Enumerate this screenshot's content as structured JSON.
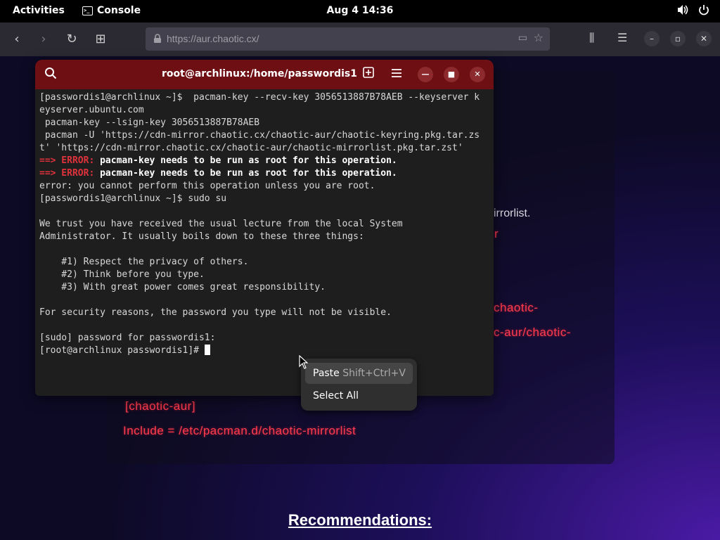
{
  "topbar": {
    "activities": "Activities",
    "app_name": "Console",
    "clock": "Aug 4  14:36"
  },
  "browser": {
    "url": "https://aur.chaotic.cx/"
  },
  "page": {
    "fragments": [
      "irrorlist.",
      "r",
      "chaotic-",
      "c-aur/chaotic-",
      "[chaotic-aur]",
      "Include = /etc/pacman.d/chaotic-mirrorlist"
    ],
    "recommendations": "Recommendations:"
  },
  "terminal": {
    "title": "root@archlinux:/home/passwordis1",
    "lines": [
      {
        "type": "plain",
        "text": "[passwordis1@archlinux ~]$  pacman-key --recv-key 3056513887B78AEB --keyserver k"
      },
      {
        "type": "plain",
        "text": "eyserver.ubuntu.com"
      },
      {
        "type": "plain",
        "text": " pacman-key --lsign-key 3056513887B78AEB"
      },
      {
        "type": "plain",
        "text": " pacman -U 'https://cdn-mirror.chaotic.cx/chaotic-aur/chaotic-keyring.pkg.tar.zs"
      },
      {
        "type": "plain",
        "text": "t' 'https://cdn-mirror.chaotic.cx/chaotic-aur/chaotic-mirrorlist.pkg.tar.zst'"
      },
      {
        "type": "error",
        "tag": "==> ERROR: ",
        "text": "pacman-key needs to be run as root for this operation."
      },
      {
        "type": "error",
        "tag": "==> ERROR: ",
        "text": "pacman-key needs to be run as root for this operation."
      },
      {
        "type": "plain",
        "text": "error: you cannot perform this operation unless you are root."
      },
      {
        "type": "plain",
        "text": "[passwordis1@archlinux ~]$ sudo su"
      },
      {
        "type": "plain",
        "text": ""
      },
      {
        "type": "plain",
        "text": "We trust you have received the usual lecture from the local System"
      },
      {
        "type": "plain",
        "text": "Administrator. It usually boils down to these three things:"
      },
      {
        "type": "plain",
        "text": ""
      },
      {
        "type": "plain",
        "text": "    #1) Respect the privacy of others."
      },
      {
        "type": "plain",
        "text": "    #2) Think before you type."
      },
      {
        "type": "plain",
        "text": "    #3) With great power comes great responsibility."
      },
      {
        "type": "plain",
        "text": ""
      },
      {
        "type": "plain",
        "text": "For security reasons, the password you type will not be visible."
      },
      {
        "type": "plain",
        "text": ""
      },
      {
        "type": "plain",
        "text": "[sudo] password for passwordis1:"
      },
      {
        "type": "prompt",
        "text": "[root@archlinux passwordis1]# "
      }
    ]
  },
  "context_menu": {
    "items": [
      {
        "label": "Paste",
        "accel": "Shift+Ctrl+V"
      },
      {
        "label": "Select All",
        "accel": ""
      }
    ]
  },
  "colors": {
    "terminal_header": "#6e0f14",
    "error_red": "#e0323c",
    "page_red": "#ff3b4e"
  },
  "icons": [
    "terminal-icon",
    "volume-icon",
    "power-icon",
    "back-icon",
    "forward-icon",
    "reload-icon",
    "new-tab-icon",
    "lock-icon",
    "reader-view-icon",
    "star-icon",
    "library-icon",
    "menu-icon",
    "search-icon",
    "new-tab-icon",
    "hamburger-menu-icon",
    "minimize-icon",
    "maximize-icon",
    "close-icon",
    "mouse-pointer-icon"
  ]
}
